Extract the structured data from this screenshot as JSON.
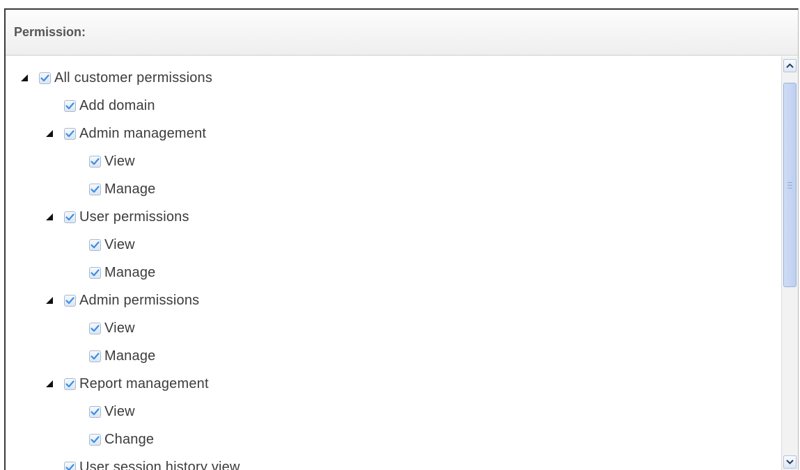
{
  "panel": {
    "title": "Permission:"
  },
  "tree": [
    {
      "label": "All customer permissions",
      "level": 0,
      "expandable": true,
      "checked": true
    },
    {
      "label": "Add domain",
      "level": 1,
      "expandable": false,
      "checked": true
    },
    {
      "label": "Admin management",
      "level": 1,
      "expandable": true,
      "checked": true
    },
    {
      "label": "View",
      "level": 2,
      "expandable": false,
      "checked": true
    },
    {
      "label": "Manage",
      "level": 2,
      "expandable": false,
      "checked": true
    },
    {
      "label": "User permissions",
      "level": 1,
      "expandable": true,
      "checked": true
    },
    {
      "label": "View",
      "level": 2,
      "expandable": false,
      "checked": true
    },
    {
      "label": "Manage",
      "level": 2,
      "expandable": false,
      "checked": true
    },
    {
      "label": "Admin permissions",
      "level": 1,
      "expandable": true,
      "checked": true
    },
    {
      "label": "View",
      "level": 2,
      "expandable": false,
      "checked": true
    },
    {
      "label": "Manage",
      "level": 2,
      "expandable": false,
      "checked": true
    },
    {
      "label": "Report management",
      "level": 1,
      "expandable": true,
      "checked": true
    },
    {
      "label": "View",
      "level": 2,
      "expandable": false,
      "checked": true
    },
    {
      "label": "Change",
      "level": 2,
      "expandable": false,
      "checked": true
    },
    {
      "label": "User session history view",
      "level": 1,
      "expandable": false,
      "checked": true
    }
  ],
  "colors": {
    "check": "#3a8ee6",
    "scroll_thumb": "#c4d5f3"
  }
}
